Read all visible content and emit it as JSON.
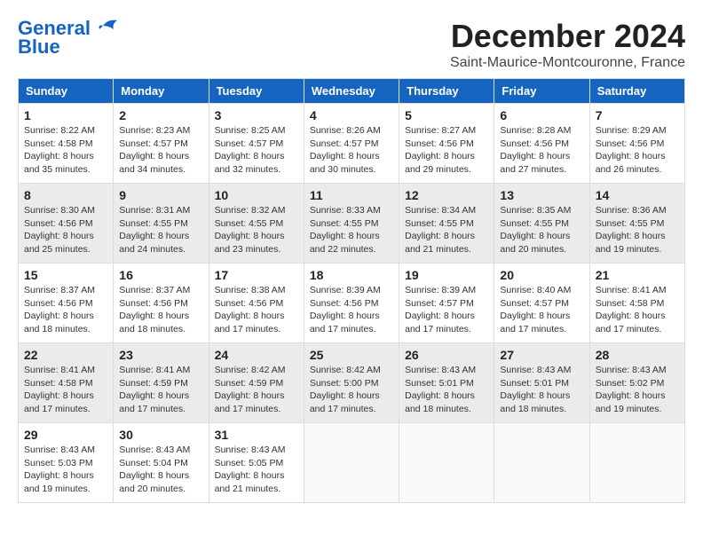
{
  "logo": {
    "line1": "General",
    "line2": "Blue"
  },
  "title": "December 2024",
  "subtitle": "Saint-Maurice-Montcouronne, France",
  "weekdays": [
    "Sunday",
    "Monday",
    "Tuesday",
    "Wednesday",
    "Thursday",
    "Friday",
    "Saturday"
  ],
  "weeks": [
    [
      {
        "day": 1,
        "sunrise": "8:22 AM",
        "sunset": "4:58 PM",
        "daylight": "8 hours and 35 minutes."
      },
      {
        "day": 2,
        "sunrise": "8:23 AM",
        "sunset": "4:57 PM",
        "daylight": "8 hours and 34 minutes."
      },
      {
        "day": 3,
        "sunrise": "8:25 AM",
        "sunset": "4:57 PM",
        "daylight": "8 hours and 32 minutes."
      },
      {
        "day": 4,
        "sunrise": "8:26 AM",
        "sunset": "4:57 PM",
        "daylight": "8 hours and 30 minutes."
      },
      {
        "day": 5,
        "sunrise": "8:27 AM",
        "sunset": "4:56 PM",
        "daylight": "8 hours and 29 minutes."
      },
      {
        "day": 6,
        "sunrise": "8:28 AM",
        "sunset": "4:56 PM",
        "daylight": "8 hours and 27 minutes."
      },
      {
        "day": 7,
        "sunrise": "8:29 AM",
        "sunset": "4:56 PM",
        "daylight": "8 hours and 26 minutes."
      }
    ],
    [
      {
        "day": 8,
        "sunrise": "8:30 AM",
        "sunset": "4:56 PM",
        "daylight": "8 hours and 25 minutes."
      },
      {
        "day": 9,
        "sunrise": "8:31 AM",
        "sunset": "4:55 PM",
        "daylight": "8 hours and 24 minutes."
      },
      {
        "day": 10,
        "sunrise": "8:32 AM",
        "sunset": "4:55 PM",
        "daylight": "8 hours and 23 minutes."
      },
      {
        "day": 11,
        "sunrise": "8:33 AM",
        "sunset": "4:55 PM",
        "daylight": "8 hours and 22 minutes."
      },
      {
        "day": 12,
        "sunrise": "8:34 AM",
        "sunset": "4:55 PM",
        "daylight": "8 hours and 21 minutes."
      },
      {
        "day": 13,
        "sunrise": "8:35 AM",
        "sunset": "4:55 PM",
        "daylight": "8 hours and 20 minutes."
      },
      {
        "day": 14,
        "sunrise": "8:36 AM",
        "sunset": "4:55 PM",
        "daylight": "8 hours and 19 minutes."
      }
    ],
    [
      {
        "day": 15,
        "sunrise": "8:37 AM",
        "sunset": "4:56 PM",
        "daylight": "8 hours and 18 minutes."
      },
      {
        "day": 16,
        "sunrise": "8:37 AM",
        "sunset": "4:56 PM",
        "daylight": "8 hours and 18 minutes."
      },
      {
        "day": 17,
        "sunrise": "8:38 AM",
        "sunset": "4:56 PM",
        "daylight": "8 hours and 17 minutes."
      },
      {
        "day": 18,
        "sunrise": "8:39 AM",
        "sunset": "4:56 PM",
        "daylight": "8 hours and 17 minutes."
      },
      {
        "day": 19,
        "sunrise": "8:39 AM",
        "sunset": "4:57 PM",
        "daylight": "8 hours and 17 minutes."
      },
      {
        "day": 20,
        "sunrise": "8:40 AM",
        "sunset": "4:57 PM",
        "daylight": "8 hours and 17 minutes."
      },
      {
        "day": 21,
        "sunrise": "8:41 AM",
        "sunset": "4:58 PM",
        "daylight": "8 hours and 17 minutes."
      }
    ],
    [
      {
        "day": 22,
        "sunrise": "8:41 AM",
        "sunset": "4:58 PM",
        "daylight": "8 hours and 17 minutes."
      },
      {
        "day": 23,
        "sunrise": "8:41 AM",
        "sunset": "4:59 PM",
        "daylight": "8 hours and 17 minutes."
      },
      {
        "day": 24,
        "sunrise": "8:42 AM",
        "sunset": "4:59 PM",
        "daylight": "8 hours and 17 minutes."
      },
      {
        "day": 25,
        "sunrise": "8:42 AM",
        "sunset": "5:00 PM",
        "daylight": "8 hours and 17 minutes."
      },
      {
        "day": 26,
        "sunrise": "8:43 AM",
        "sunset": "5:01 PM",
        "daylight": "8 hours and 18 minutes."
      },
      {
        "day": 27,
        "sunrise": "8:43 AM",
        "sunset": "5:01 PM",
        "daylight": "8 hours and 18 minutes."
      },
      {
        "day": 28,
        "sunrise": "8:43 AM",
        "sunset": "5:02 PM",
        "daylight": "8 hours and 19 minutes."
      }
    ],
    [
      {
        "day": 29,
        "sunrise": "8:43 AM",
        "sunset": "5:03 PM",
        "daylight": "8 hours and 19 minutes."
      },
      {
        "day": 30,
        "sunrise": "8:43 AM",
        "sunset": "5:04 PM",
        "daylight": "8 hours and 20 minutes."
      },
      {
        "day": 31,
        "sunrise": "8:43 AM",
        "sunset": "5:05 PM",
        "daylight": "8 hours and 21 minutes."
      },
      null,
      null,
      null,
      null
    ]
  ]
}
